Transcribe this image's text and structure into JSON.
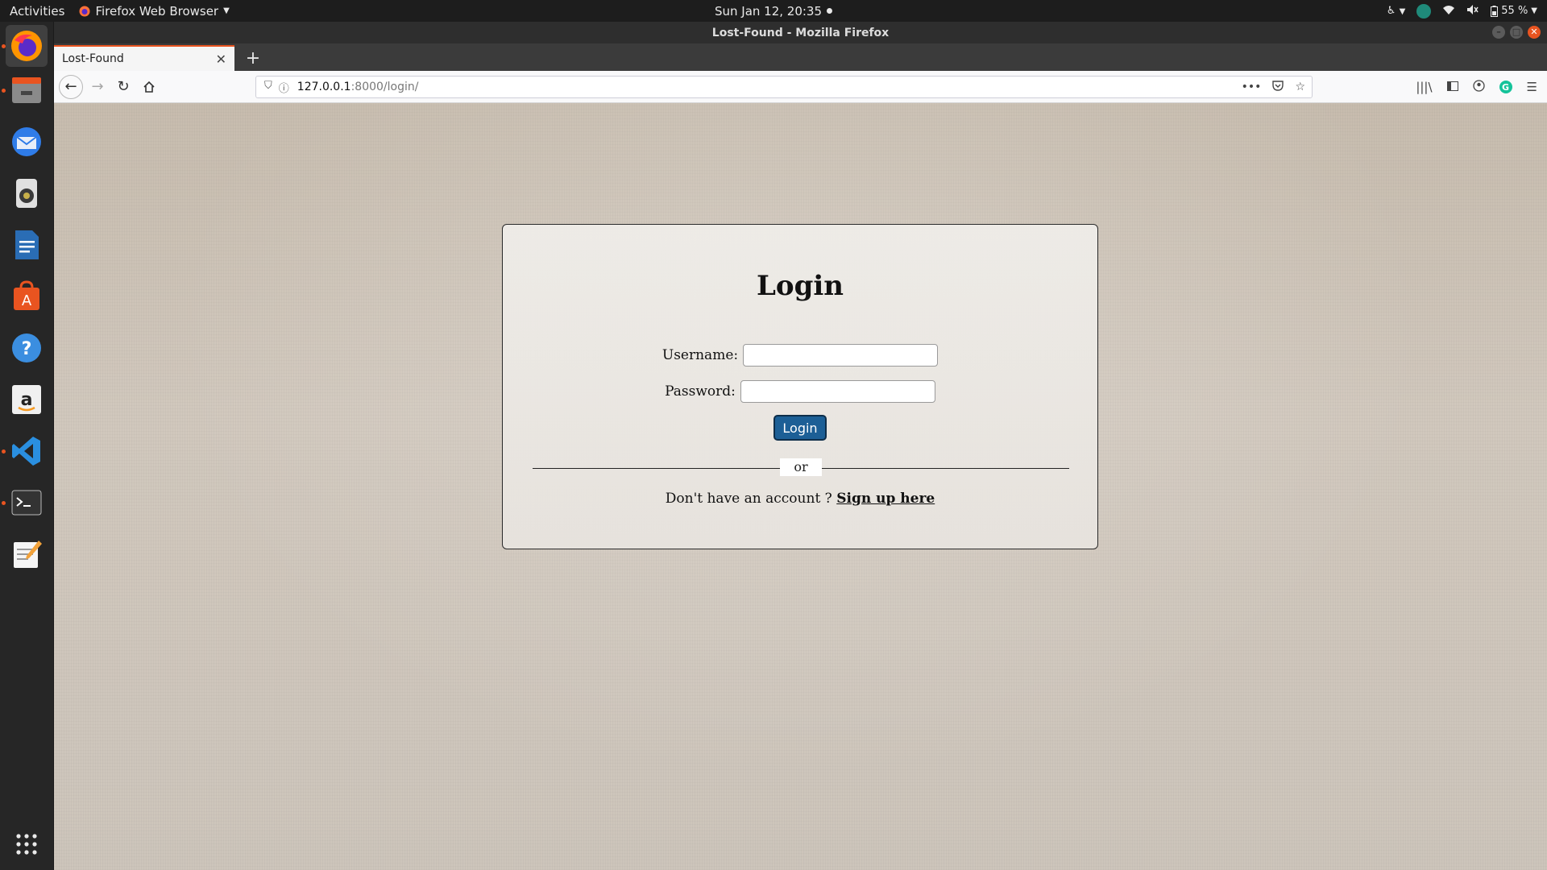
{
  "topbar": {
    "activities": "Activities",
    "app_name": "Firefox Web Browser",
    "clock": "Sun Jan 12, 20:35",
    "battery": "55 %"
  },
  "dock": {
    "items": [
      {
        "name": "firefox",
        "icon": "firefox-icon"
      },
      {
        "name": "files",
        "icon": "files-icon"
      },
      {
        "name": "thunderbird",
        "icon": "thunderbird-icon"
      },
      {
        "name": "rhythmbox",
        "icon": "rhythmbox-icon"
      },
      {
        "name": "libreoffice-writer",
        "icon": "writer-icon"
      },
      {
        "name": "ubuntu-software",
        "icon": "software-icon"
      },
      {
        "name": "help",
        "icon": "help-icon"
      },
      {
        "name": "amazon",
        "icon": "amazon-icon"
      },
      {
        "name": "vscode",
        "icon": "vscode-icon"
      },
      {
        "name": "terminal",
        "icon": "terminal-icon"
      },
      {
        "name": "text-editor",
        "icon": "text-editor-icon"
      },
      {
        "name": "show-applications",
        "icon": "app-grid-icon"
      }
    ],
    "accent": "#e95420"
  },
  "browser": {
    "window_title": "Lost-Found - Mozilla Firefox",
    "tab_title": "Lost-Found",
    "url_host": "127.0.0.1",
    "url_path": ":8000/login/"
  },
  "page": {
    "title": "Login",
    "username_label": "Username:",
    "password_label": "Password:",
    "username_value": "",
    "password_value": "",
    "login_button": "Login",
    "divider_text": "or",
    "signup_prompt": "Don't have an account ? ",
    "signup_link": "Sign up here",
    "button_color": "#1c5f96"
  }
}
